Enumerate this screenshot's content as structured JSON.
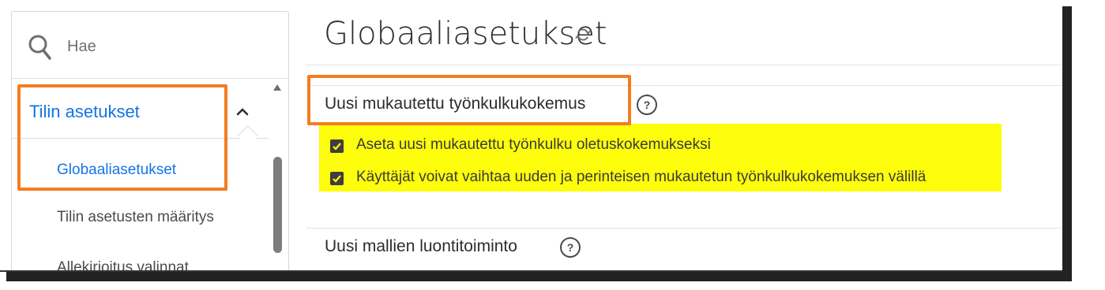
{
  "search": {
    "placeholder": "Hae"
  },
  "sidebar": {
    "section_title": "Tilin asetukset",
    "items": [
      {
        "label": "Globaaliasetukset",
        "active": true
      },
      {
        "label": "Tilin asetusten määritys",
        "active": false
      },
      {
        "label": "Allekirjoitus valinnat",
        "active": false
      }
    ]
  },
  "main": {
    "title": "Globaaliasetukset",
    "sections": [
      {
        "title": "Uusi mukautettu työnkulkukokemus",
        "help": "?",
        "options": [
          {
            "label": "Aseta uusi mukautettu työnkulku oletuskokemukseksi",
            "checked": true
          },
          {
            "label": "Käyttäjät voivat vaihtaa uuden ja perinteisen mukautetun työnkulkukokemuksen välillä",
            "checked": true
          }
        ]
      },
      {
        "title": "Uusi mallien luontitoiminto",
        "help": "?"
      }
    ]
  },
  "colors": {
    "accent": "#1473e6",
    "callout": "#f47c20",
    "highlight": "#fdfd0c"
  }
}
